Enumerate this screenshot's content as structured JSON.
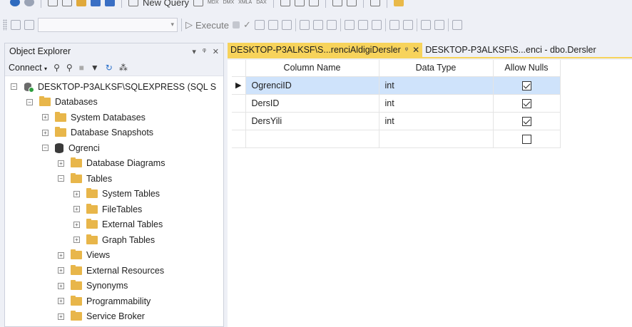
{
  "toolbar": {
    "new_query_label": "New Query",
    "execute_label": "Execute"
  },
  "object_explorer": {
    "title": "Object Explorer",
    "title_buttons": [
      "▾",
      "ᵠ",
      "✕"
    ],
    "connect_label": "Connect",
    "tree": [
      {
        "label": "DESKTOP-P3ALKSF\\SQLEXPRESS (SQL S",
        "expander": "−"
      },
      {
        "label": "Databases",
        "expander": "−"
      },
      {
        "label": "System Databases",
        "expander": "+"
      },
      {
        "label": "Database Snapshots",
        "expander": "+"
      },
      {
        "label": "Ogrenci",
        "expander": "−"
      },
      {
        "label": "Database Diagrams",
        "expander": "+"
      },
      {
        "label": "Tables",
        "expander": "−"
      },
      {
        "label": "System Tables",
        "expander": "+"
      },
      {
        "label": "FileTables",
        "expander": "+"
      },
      {
        "label": "External Tables",
        "expander": "+"
      },
      {
        "label": "Graph Tables",
        "expander": "+"
      },
      {
        "label": "Views",
        "expander": "+"
      },
      {
        "label": "External Resources",
        "expander": "+"
      },
      {
        "label": "Synonyms",
        "expander": "+"
      },
      {
        "label": "Programmability",
        "expander": "+"
      },
      {
        "label": "Service Broker",
        "expander": "+"
      }
    ]
  },
  "tabs": [
    {
      "label": "DESKTOP-P3ALKSF\\S...renciAldigiDersler",
      "active": true,
      "pin": "ᵠ",
      "close": "✕"
    },
    {
      "label": "DESKTOP-P3ALKSF\\S...enci - dbo.Dersler",
      "active": false
    }
  ],
  "designer": {
    "columns": [
      "Column Name",
      "Data Type",
      "Allow Nulls"
    ],
    "rows": [
      {
        "name": "OgrenciID",
        "type": "int",
        "allow_nulls": true,
        "selected": true
      },
      {
        "name": "DersID",
        "type": "int",
        "allow_nulls": true,
        "selected": false
      },
      {
        "name": "DersYili",
        "type": "int",
        "allow_nulls": true,
        "selected": false
      },
      {
        "name": "",
        "type": "",
        "allow_nulls": false,
        "selected": false
      }
    ],
    "row_indicator": "▶"
  },
  "colors": {
    "active_tab": "#f7d35b",
    "selected_row": "#cfe3fb",
    "folder": "#e8b64a",
    "server_status": "#2e9e3e"
  }
}
